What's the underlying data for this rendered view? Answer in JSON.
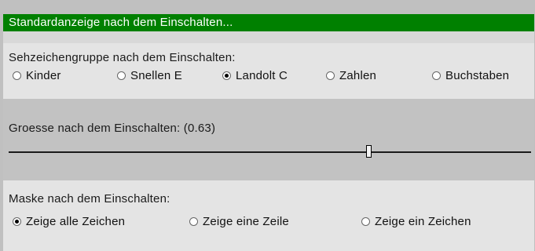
{
  "header": {
    "title": "Standardanzeige nach dem Einschalten..."
  },
  "symbol_group": {
    "label": "Sehzeichengruppe nach dem Einschalten:",
    "options": [
      "Kinder",
      "Snellen E",
      "Landolt C",
      "Zahlen",
      "Buchstaben"
    ],
    "selected": "Landolt C"
  },
  "size": {
    "label": "Groesse nach dem Einschalten: (0.63)",
    "slider_fraction": 0.69
  },
  "mask": {
    "label": "Maske nach dem Einschalten:",
    "options": [
      "Zeige alle Zeichen",
      "Zeige eine Zeile",
      "Zeige ein Zeichen"
    ],
    "selected": "Zeige alle Zeichen"
  },
  "colors": {
    "title_bg": "#008000",
    "title_text": "#ffffff"
  }
}
